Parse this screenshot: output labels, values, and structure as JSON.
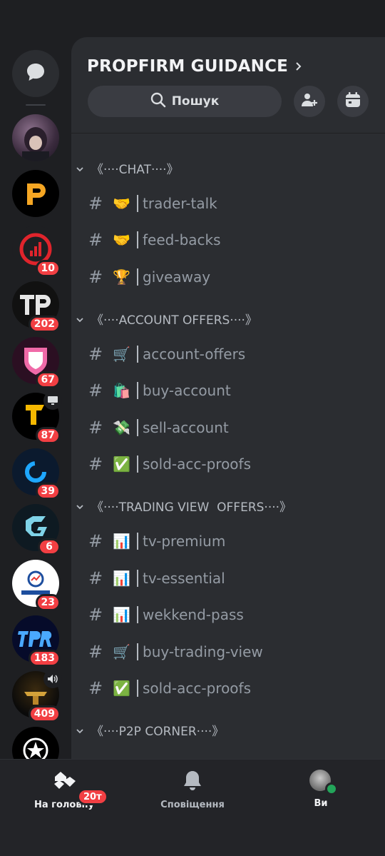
{
  "server_rail": {
    "servers": [
      {
        "name": "anime-avatar",
        "badge": ""
      },
      {
        "name": "p-logo",
        "badge": ""
      },
      {
        "name": "red-chart-logo",
        "badge": "10"
      },
      {
        "name": "tp-logo",
        "badge": "202"
      },
      {
        "name": "pink-shield-logo",
        "badge": "67"
      },
      {
        "name": "tradl-logo",
        "badge": "87"
      },
      {
        "name": "blue-ring-logo",
        "badge": "39"
      },
      {
        "name": "g-logo",
        "badge": "6"
      },
      {
        "name": "propfirm-logo",
        "badge": "23"
      },
      {
        "name": "tpr-logo",
        "badge": "183"
      },
      {
        "name": "gold-logo",
        "badge": "409"
      },
      {
        "name": "star-logo",
        "badge": ""
      }
    ]
  },
  "header": {
    "title": "PROPFIRM GUIDANCE",
    "search_label": "Пошук"
  },
  "categories": [
    {
      "label": "《····CHAT····》",
      "channels": [
        {
          "emoji": "🤝",
          "name": "trader-talk"
        },
        {
          "emoji": "🤝",
          "name": "feed-backs"
        },
        {
          "emoji": "🏆",
          "name": "giveaway"
        }
      ]
    },
    {
      "label": "《····ACCOUNT OFFERS····》",
      "channels": [
        {
          "emoji": "🛒",
          "name": "account-offers"
        },
        {
          "emoji": "🛍️",
          "name": "buy-account"
        },
        {
          "emoji": "💸",
          "name": "sell-account"
        },
        {
          "emoji": "✅",
          "name": "sold-acc-proofs"
        }
      ]
    },
    {
      "label": "《····TRADING VIEW  OFFERS····》",
      "channels": [
        {
          "emoji": "📊",
          "name": "tv-premium"
        },
        {
          "emoji": "📊",
          "name": "tv-essential"
        },
        {
          "emoji": "📊",
          "name": "wekkend-pass"
        },
        {
          "emoji": "🛒",
          "name": "buy-trading-view"
        },
        {
          "emoji": "✅",
          "name": "sold-acc-proofs"
        }
      ]
    },
    {
      "label": "《····P2P CORNER····》",
      "channels": []
    }
  ],
  "nav": {
    "home_label": "На головну",
    "home_badge": "20т",
    "notifications_label": "Сповіщення",
    "profile_label": "Ви"
  },
  "colors": {
    "accent_red": "#f23f43",
    "status_online": "#23a55a",
    "panel_bg": "#2b2d31"
  }
}
